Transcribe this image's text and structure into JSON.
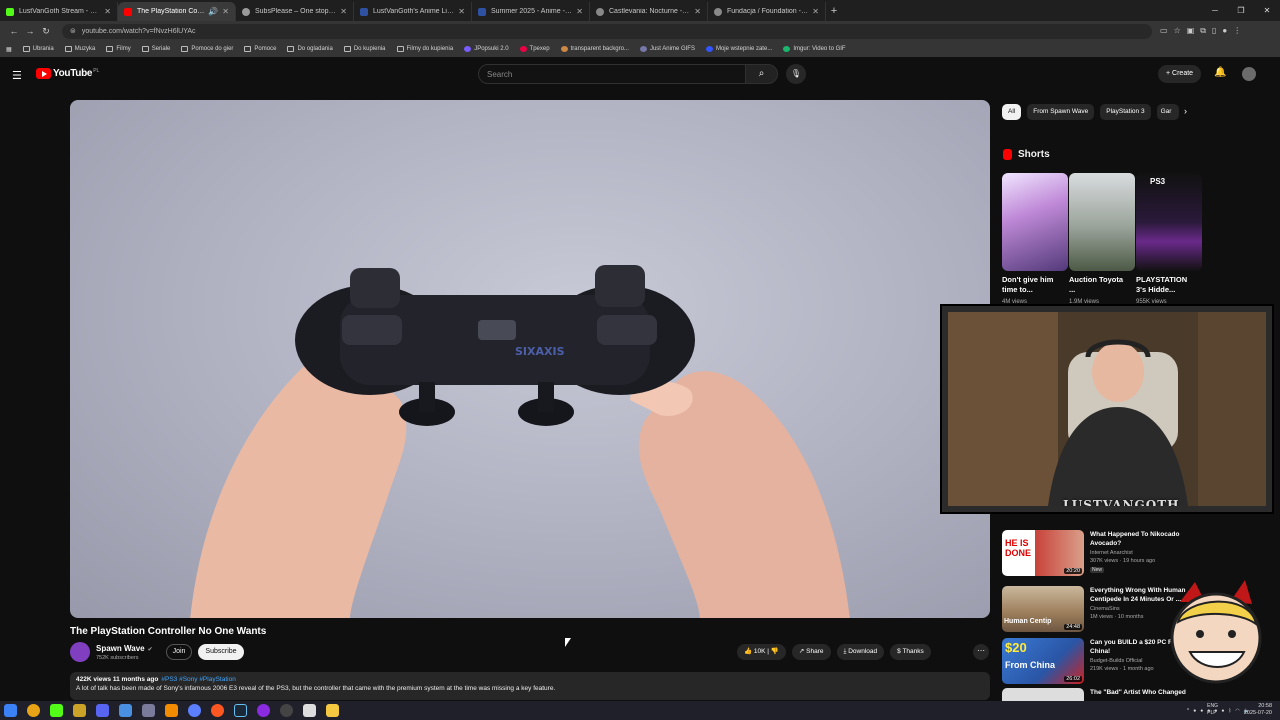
{
  "browser": {
    "tabs": [
      {
        "label": "LustVanGoth Stream - Watch L",
        "color": "#53fc18"
      },
      {
        "label": "The PlayStation Controller",
        "color": "#ff0000"
      },
      {
        "label": "SubsPlease – One stop shop fo",
        "color": "#9a9a9a"
      },
      {
        "label": "LustVanGoth's Anime List - My",
        "color": "#2e51a2"
      },
      {
        "label": "Summer 2025 - Anime - MyAn",
        "color": "#2e51a2"
      },
      {
        "label": "Castlevania: Nocturne - Sezon",
        "color": "#888888"
      },
      {
        "label": "Fundacja / Foundation - Sezon",
        "color": "#888888"
      }
    ],
    "url": "youtube.com/watch?v=fNvzH6lUYAc",
    "bookmarks": [
      "Ubrania",
      "Muzyka",
      "Filmy",
      "Seriale",
      "Pomoce do gier",
      "Pomoce",
      "Do ogladania",
      "Do kupienia",
      "Filmy do kupienia",
      "JPopsuki 2.0",
      "Tpexep",
      "transparent backgro...",
      "Just Anime GIFS",
      "Moje wstepnie zate...",
      "Imgur: Video to GIF"
    ]
  },
  "youtube": {
    "logo_text": "YouTube",
    "country": "PL",
    "search_placeholder": "Search",
    "create_label": "Create"
  },
  "video": {
    "title": "The PlayStation Controller No One Wants",
    "channel": "Spawn Wave",
    "subscribers": "752K subscribers",
    "join_label": "Join",
    "subscribe_label": "Subscribe",
    "likes": "10K",
    "share_label": "Share",
    "download_label": "Download",
    "thanks_label": "Thanks",
    "views_time": "422K views  11 months ago",
    "tags": "#PS3 #Sony #PlayStation",
    "description": "A lot of talk has been made of Sony's infamous 2006 E3 reveal of the PS3, but the controller that came with the premium system at the time was missing a key feature."
  },
  "sidebar": {
    "chips": [
      "All",
      "From Spawn Wave",
      "PlayStation 3",
      "Gar"
    ],
    "shorts_title": "Shorts",
    "shorts": [
      {
        "title": "Don't give him time to...",
        "views": "4M views"
      },
      {
        "title": "Auction Toyota ...",
        "views": "1.9M views"
      },
      {
        "title": "PLAYSTATION 3's Hidde...",
        "views": "955K views"
      }
    ],
    "recs": [
      {
        "title": "What Happened To Nikocado Avocado?",
        "channel": "Internet Anarchist",
        "views": "307K views · 19 hours ago",
        "duration": "20:20",
        "badge": "New"
      },
      {
        "title": "Everything Wrong With Human Centipede In 24 Minutes Or ...",
        "channel": "CinemaSins",
        "views": "1M views · 10 months",
        "duration": "24:48",
        "badge": ""
      },
      {
        "title": "Can you BUILD a $20 PC From China!",
        "channel": "Budget-Builds Official",
        "views": "219K views · 1 month ago",
        "duration": "26:02",
        "badge": ""
      },
      {
        "title": "The \"Bad\" Artist Who Changed",
        "channel": "",
        "views": "",
        "duration": "",
        "badge": ""
      }
    ]
  },
  "overlay": {
    "streamer_name": "LUSTVANGOTH"
  },
  "taskbar": {
    "lang": "ENG\nPLP",
    "time": "20:58",
    "date": "2025-07-20"
  },
  "colors": {
    "yt_red": "#ff0000",
    "bg": "#0f0f0f",
    "chip_bg": "#272727",
    "link_blue": "#3ea6ff"
  }
}
